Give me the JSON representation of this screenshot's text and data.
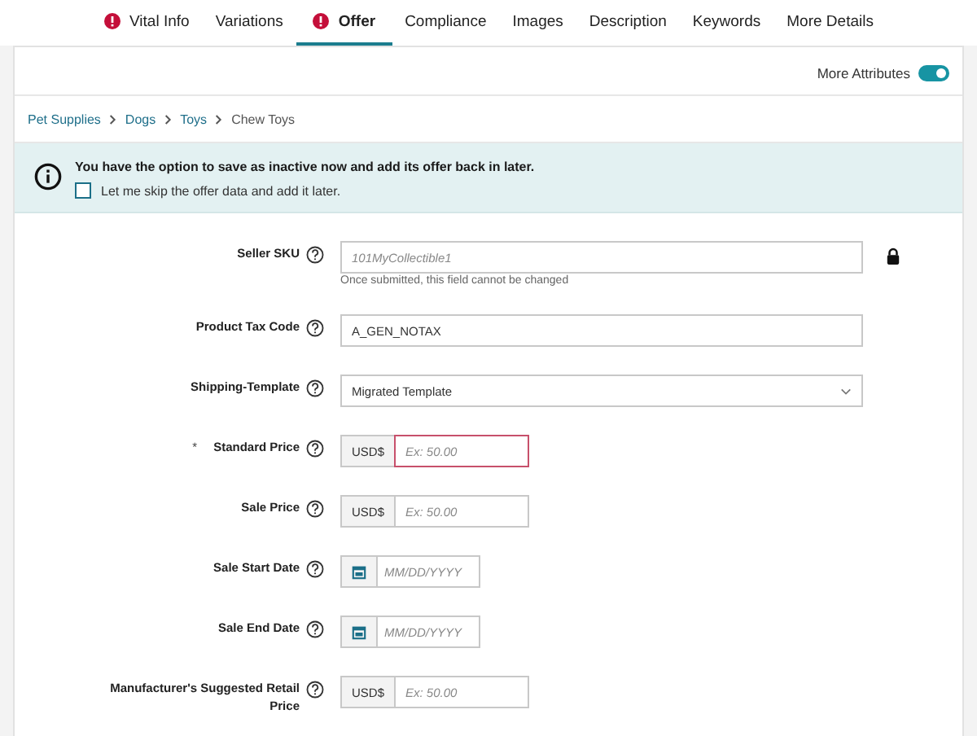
{
  "tabs": [
    {
      "label": "Vital Info",
      "selected": false,
      "error": true
    },
    {
      "label": "Variations",
      "selected": false,
      "error": false
    },
    {
      "label": "Offer",
      "selected": true,
      "error": true
    },
    {
      "label": "Compliance",
      "selected": false,
      "error": false
    },
    {
      "label": "Images",
      "selected": false,
      "error": false
    },
    {
      "label": "Description",
      "selected": false,
      "error": false
    },
    {
      "label": "Keywords",
      "selected": false,
      "error": false
    },
    {
      "label": "More Details",
      "selected": false,
      "error": false
    }
  ],
  "more_attributes": {
    "label": "More Attributes",
    "on": true
  },
  "breadcrumb": [
    {
      "label": "Pet Supplies",
      "kind": "link"
    },
    {
      "label": "Dogs",
      "kind": "link"
    },
    {
      "label": "Toys",
      "kind": "link"
    },
    {
      "label": "Chew Toys",
      "kind": "current"
    }
  ],
  "notice": {
    "message": "You have the option to save as inactive now and add its offer back in later.",
    "checkbox": {
      "label": "Let me skip the offer data and add it later.",
      "checked": false
    }
  },
  "fields": [
    {
      "kind": "text",
      "label": "Seller SKU",
      "placeholder": "101MyCollectible1",
      "locked": true,
      "hint": "Once submitted, this field cannot be changed"
    },
    {
      "kind": "text",
      "label": "Product Tax Code",
      "value": "A_GEN_NOTAX",
      "locked": false
    },
    {
      "kind": "select",
      "label": "Shipping-Template",
      "value": "Migrated Template"
    },
    {
      "kind": "price",
      "label": "Standard Price",
      "marker": "*",
      "prefix": "USD$",
      "placeholder": "Ex: 50.00",
      "error": true
    },
    {
      "kind": "price",
      "label": "Sale Price",
      "prefix": "USD$",
      "placeholder": "Ex: 50.00",
      "error": false
    },
    {
      "kind": "date",
      "label": "Sale Start Date",
      "placeholder": "MM/DD/YYYY"
    },
    {
      "kind": "date",
      "label": "Sale End Date",
      "placeholder": "MM/DD/YYYY"
    },
    {
      "kind": "price",
      "label": "Manufacturer's Suggested Retail Price",
      "prefix": "USD$",
      "placeholder": "Ex: 50.00",
      "error": false
    }
  ]
}
